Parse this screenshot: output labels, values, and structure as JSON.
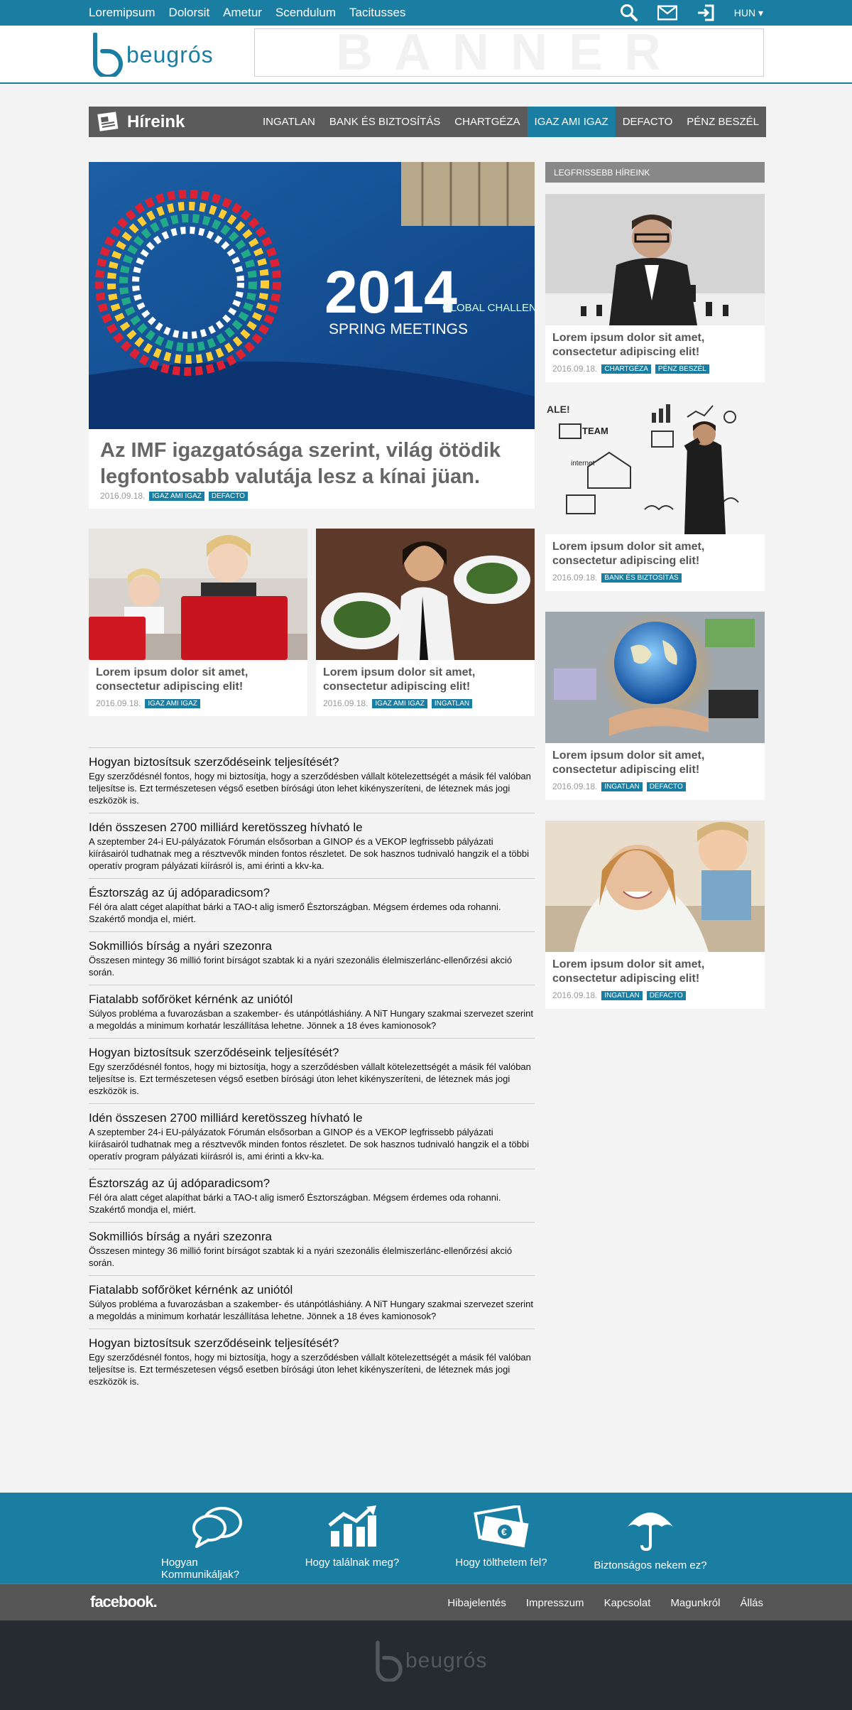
{
  "topnav": [
    "Loremipsum",
    "Dolorsit",
    "Ametur",
    "Scendulum",
    "Tacitusses"
  ],
  "lang": "HUN ▾",
  "logo_text": "beugrós",
  "banner_text": "BANNER",
  "section": {
    "title": "Híreink",
    "tabs": [
      "INGATLAN",
      "BANK ÉS BIZTOSÍTÁS",
      "CHARTGÉZA",
      "IGAZ AMI IGAZ",
      "DEFACTO",
      "PÉNZ BESZÉL"
    ],
    "active_tab": "IGAZ AMI IGAZ"
  },
  "hero": {
    "image_text": {
      "year": "2014",
      "line": "SPRING MEETINGS",
      "global": "GLOBAL CHALLENGES"
    },
    "title": "Az IMF igazgatósága szerint, világ ötödik legfontosabb valutája lesz a kínai jüan.",
    "date": "2016.09.18.",
    "tags": [
      "IGAZ AMI IGAZ",
      "DEFACTO"
    ]
  },
  "small_cards": [
    {
      "title": "Lorem ipsum dolor sit amet, consectetur adipiscing elit!",
      "date": "2016.09.18.",
      "tags": [
        "IGAZ AMI IGAZ"
      ]
    },
    {
      "title": "Lorem ipsum dolor sit amet, consectetur adipiscing elit!",
      "date": "2016.09.18.",
      "tags": [
        "IGAZ AMI IGAZ",
        "INGATLAN"
      ]
    }
  ],
  "sidebar": {
    "heading": "LEGFRISSEBB HÍREINK",
    "cards": [
      {
        "title": "Lorem ipsum dolor sit amet, consectetur adipiscing elit!",
        "date": "2016.09.18.",
        "tags": [
          "CHARTGÉZA",
          "PÉNZ BESZÉL"
        ]
      },
      {
        "title": "Lorem ipsum dolor sit amet, consectetur adipiscing elit!",
        "date": "2016.09.18.",
        "tags": [
          "BANK ÉS BIZTOSÍTÁS"
        ]
      },
      {
        "title": "Lorem ipsum dolor sit amet, consectetur adipiscing elit!",
        "date": "2016.09.18.",
        "tags": [
          "INGATLAN",
          "DEFACTO"
        ]
      },
      {
        "title": "Lorem ipsum dolor sit amet, consectetur adipiscing elit!",
        "date": "2016.09.18.",
        "tags": [
          "INGATLAN",
          "DEFACTO"
        ]
      }
    ],
    "image_text": {
      "team": "TEAM",
      "internet": "internet",
      "ale": "ALE!"
    }
  },
  "news": [
    {
      "title": "Hogyan biztosítsuk szerződéseink teljesítését?",
      "text": "Egy szerződésnél fontos, hogy mi biztosítja, hogy a szerződésben vállalt kötelezettségét a másik fél valóban teljesítse is. Ezt természetesen végső esetben bírósági úton lehet kikényszeríteni, de léteznek más jogi eszközök is."
    },
    {
      "title": "Idén összesen 2700 milliárd keretösszeg hívható le",
      "text": "A szeptember 24-i EU-pályázatok Fórumán elsősorban a GINOP és a VEKOP legfrissebb pályázati kiírásairól tudhatnak meg a résztvevők minden fontos részletet. De sok hasznos tudnivaló hangzik el a többi operatív program pályázati kiírásról is, ami érinti a kkv-ka."
    },
    {
      "title": "Észtország az új adóparadicsom?",
      "text": "Fél óra alatt céget alapíthat bárki a TAO-t alig ismerő Észtországban. Mégsem érdemes oda rohanni. Szakértő mondja el, miért."
    },
    {
      "title": "Sokmilliós bírság a nyári szezonra",
      "text": "Összesen mintegy 36 millió forint bírságot szabtak ki a nyári szezonális élelmiszerlánc-ellenőrzési akció során."
    },
    {
      "title": "Fiatalabb sofőröket kérnénk az uniótól",
      "text": "Súlyos probléma a fuvarozásban a szakember- és utánpótláshiány. A NiT Hungary szakmai szervezet szerint a megoldás a minimum korhatár leszállítása lehetne. Jönnek a 18 éves kamionosok?"
    },
    {
      "title": "Hogyan biztosítsuk szerződéseink teljesítését?",
      "text": "Egy szerződésnél fontos, hogy mi biztosítja, hogy a szerződésben vállalt kötelezettségét a másik fél valóban teljesítse is. Ezt természetesen végső esetben bírósági úton lehet kikényszeríteni, de léteznek más jogi eszközök is."
    },
    {
      "title": "Idén összesen 2700 milliárd keretösszeg hívható le",
      "text": "A szeptember 24-i EU-pályázatok Fórumán elsősorban a GINOP és a VEKOP legfrissebb pályázati kiírásairól tudhatnak meg a résztvevők minden fontos részletet. De sok hasznos tudnivaló hangzik el a többi operatív program pályázati kiírásról is, ami érinti a kkv-ka."
    },
    {
      "title": "Észtország az új adóparadicsom?",
      "text": "Fél óra alatt céget alapíthat bárki a TAO-t alig ismerő Észtországban. Mégsem érdemes oda rohanni. Szakértő mondja el, miért."
    },
    {
      "title": "Sokmilliós bírság a nyári szezonra",
      "text": "Összesen mintegy 36 millió forint bírságot szabtak ki a nyári szezonális élelmiszerlánc-ellenőrzési akció során."
    },
    {
      "title": "Fiatalabb sofőröket kérnénk az uniótól",
      "text": "Súlyos probléma a fuvarozásban a szakember- és utánpótláshiány. A NiT Hungary szakmai szervezet szerint a megoldás a minimum korhatár leszállítása lehetne. Jönnek a 18 éves kamio­nosok?"
    },
    {
      "title": "Hogyan biztosítsuk szerződéseink teljesítését?",
      "text": "Egy szerződésnél fontos, hogy mi biztosítja, hogy a szerződésben vállalt kötelezettségét a másik fél valóban teljesítse is. Ezt természetesen végső esetben bírósági úton lehet kikényszeríteni, de léteznek más jogi eszközök is."
    }
  ],
  "footer_features": [
    "Hogyan Kommunikáljak?",
    "Hogy találnak meg?",
    "Hogy tölthetem fel?",
    "Biztonságos nekem ez?"
  ],
  "footer_brand": "facebook.",
  "footer_links": [
    "Hibajelentés",
    "Impresszum",
    "Kapcsolat",
    "Magunkról",
    "Állás"
  ],
  "colors": {
    "accent": "#1a7ea3",
    "dark_nav": "#5b5b5b",
    "footer_dark": "#262a31"
  }
}
